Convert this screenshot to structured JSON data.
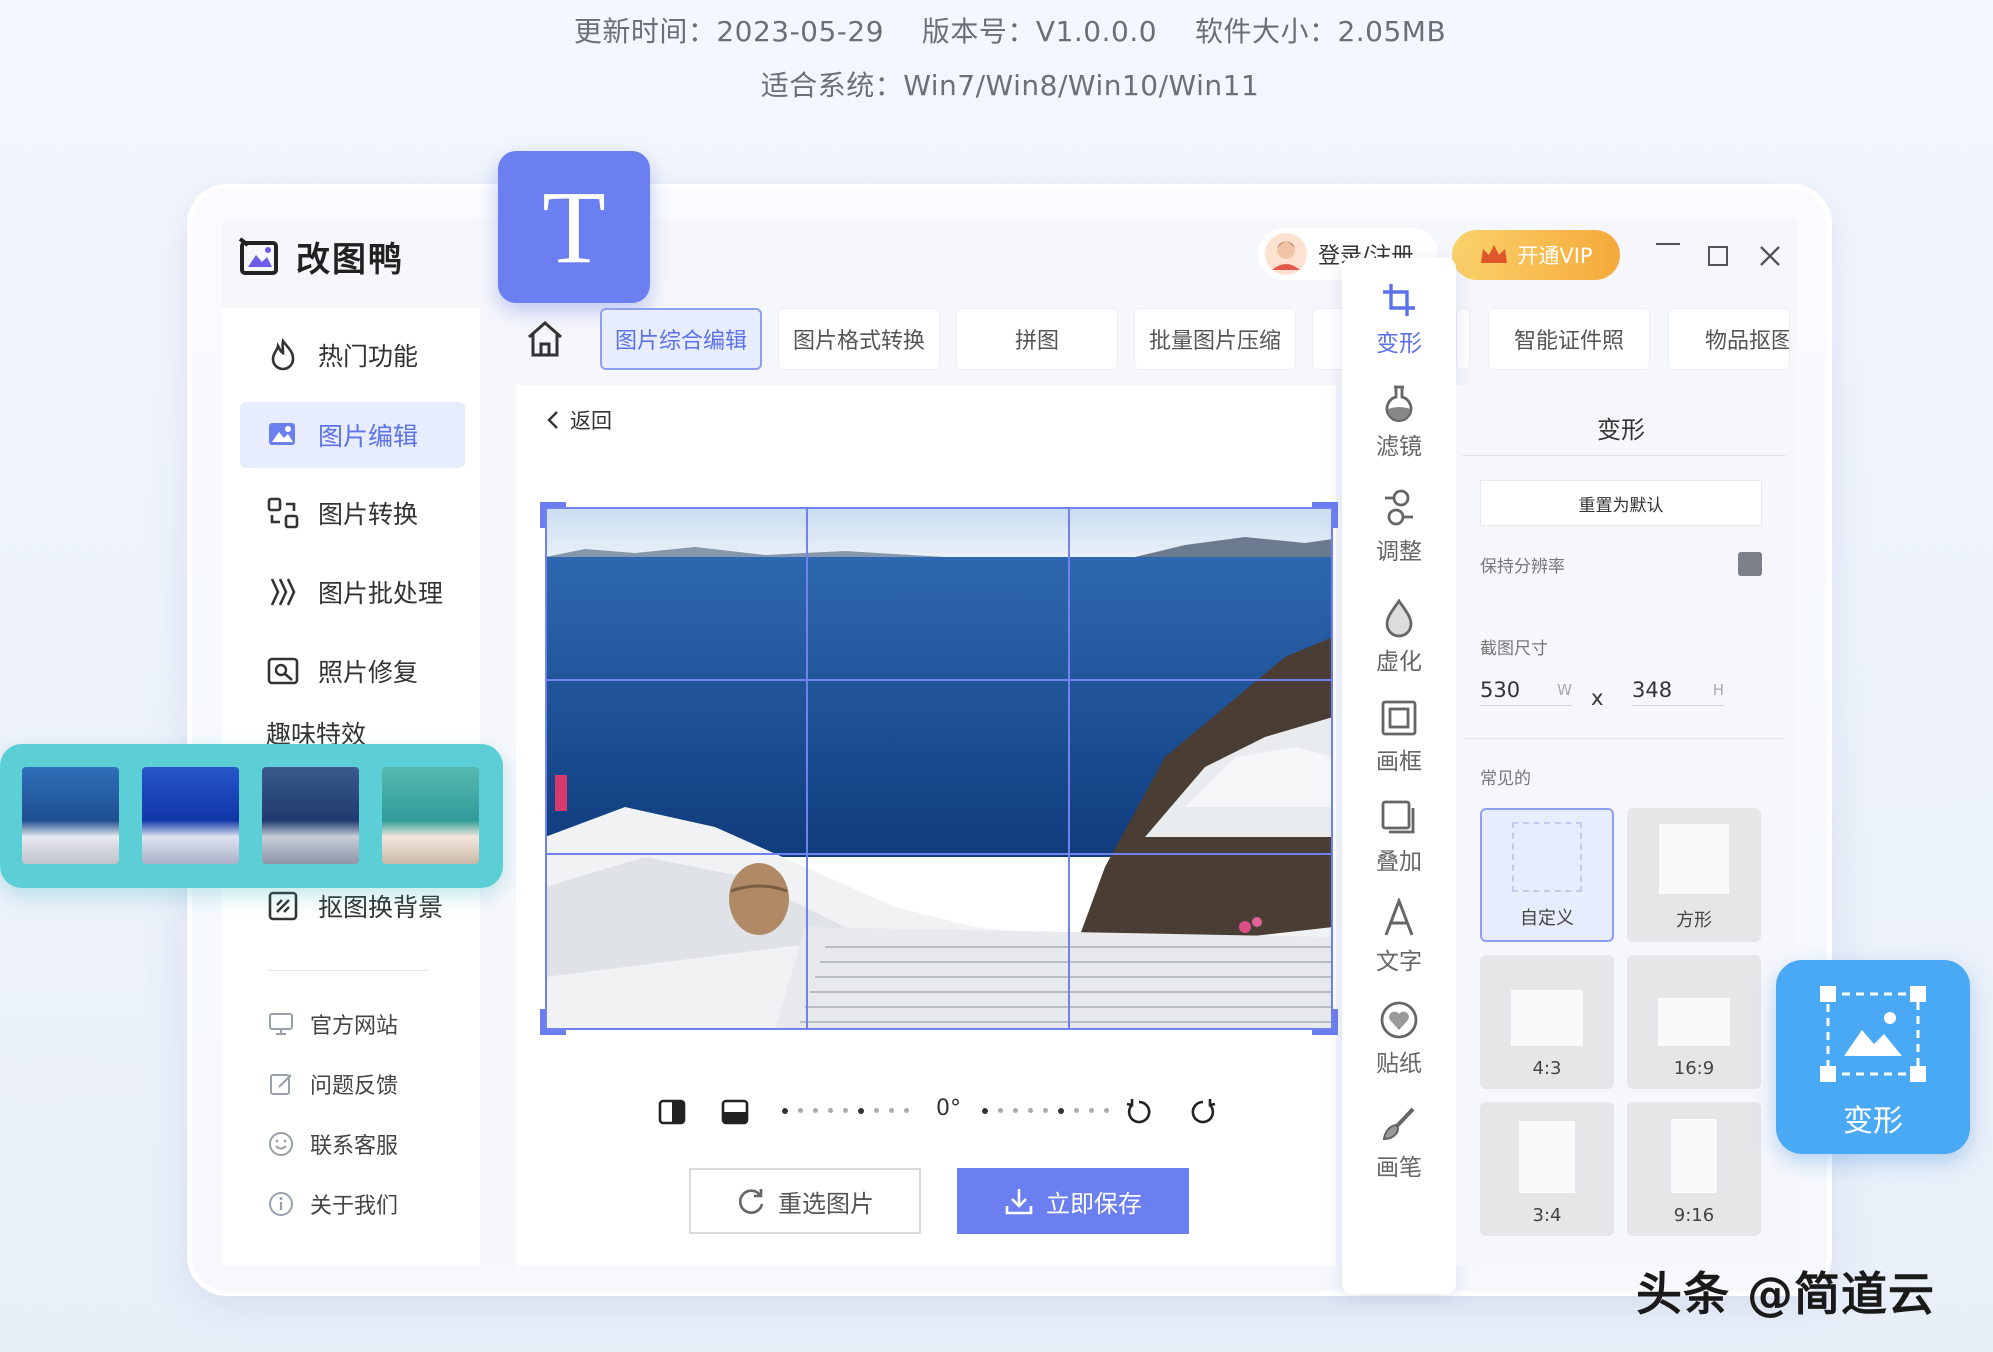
{
  "header": {
    "line1": "更新时间：2023-05-29　 版本号：V1.0.0.0　 软件大小：2.05MB",
    "line2": "适合系统：Win7/Win8/Win10/Win11"
  },
  "app": {
    "name": "改图鸭",
    "login": "登录/注册",
    "vip": "开通VIP"
  },
  "badge_text_tool": "T",
  "sidebar": {
    "items": [
      {
        "label": "热门功能"
      },
      {
        "label": "图片编辑"
      },
      {
        "label": "图片转换"
      },
      {
        "label": "图片批处理"
      },
      {
        "label": "照片修复"
      },
      {
        "label": "趣味特效"
      },
      {
        "label": "抠图换背景"
      }
    ],
    "footer": [
      {
        "label": "官方网站"
      },
      {
        "label": "问题反馈"
      },
      {
        "label": "联系客服"
      },
      {
        "label": "关于我们"
      }
    ]
  },
  "tabs": [
    {
      "label": "图片综合编辑"
    },
    {
      "label": "图片格式转换"
    },
    {
      "label": "拼图"
    },
    {
      "label": "批量图片压缩"
    },
    {
      "label": "智能证件照"
    },
    {
      "label": "物品抠图"
    }
  ],
  "editor": {
    "back": "返回",
    "rotation": "0°",
    "reselect": "重选图片",
    "save": "立即保存"
  },
  "tools": [
    {
      "label": "变形"
    },
    {
      "label": "滤镜"
    },
    {
      "label": "调整"
    },
    {
      "label": "虚化"
    },
    {
      "label": "画框"
    },
    {
      "label": "叠加"
    },
    {
      "label": "文字"
    },
    {
      "label": "贴纸"
    },
    {
      "label": "画笔"
    }
  ],
  "panel": {
    "title": "变形",
    "reset": "重置为默认",
    "keep_resolution": "保持分辨率",
    "crop_size": "截图尺寸",
    "width": "530",
    "w": "W",
    "x": "x",
    "height": "348",
    "h": "H",
    "common": "常见的",
    "presets": [
      {
        "label": "自定义"
      },
      {
        "label": "方形"
      },
      {
        "label": "4:3"
      },
      {
        "label": "16:9"
      },
      {
        "label": "3:4"
      },
      {
        "label": "9:16"
      }
    ]
  },
  "badge_transform": "变形",
  "watermark": "头条 @简道云",
  "colors": {
    "accent": "#6b7ff0",
    "teal": "#5ccfd6",
    "blue_badge": "#49a9f4",
    "vip": "#f6b33c"
  }
}
